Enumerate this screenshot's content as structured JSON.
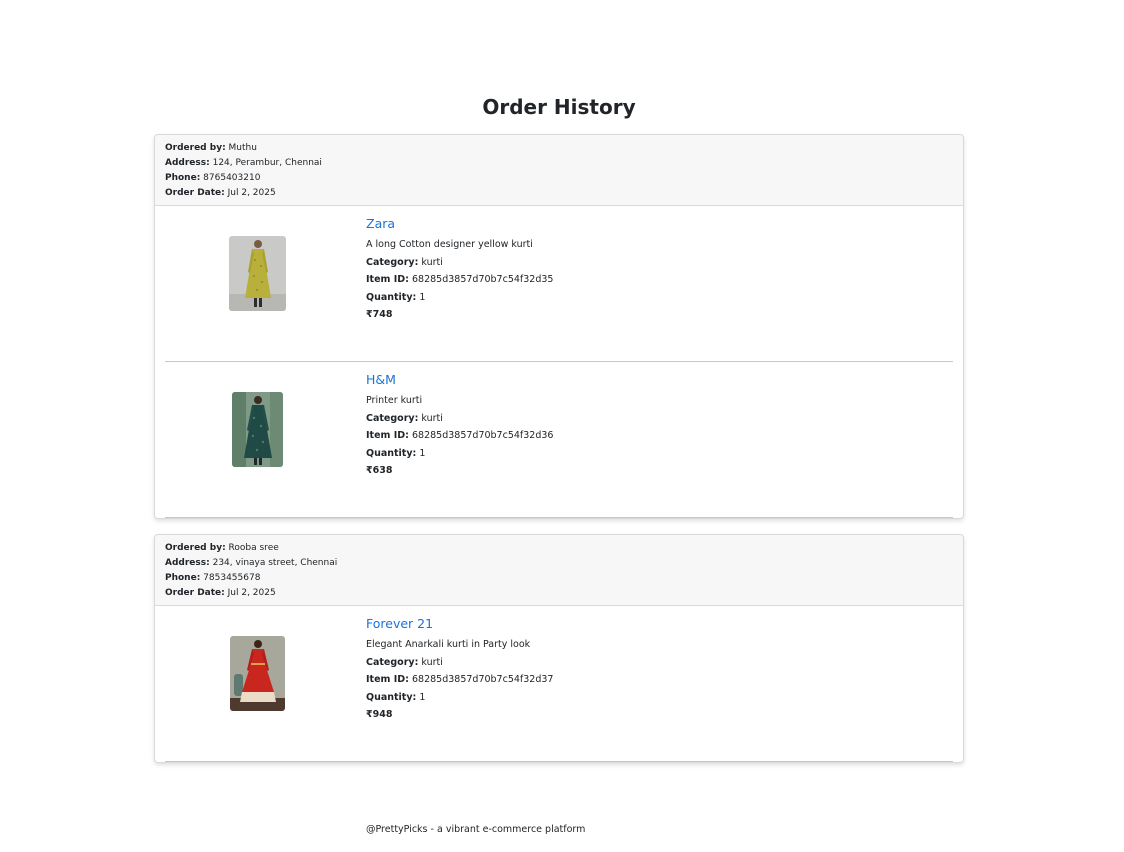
{
  "page": {
    "title": "Order History"
  },
  "labels": {
    "ordered_by": "Ordered by:",
    "address": "Address:",
    "phone": "Phone:",
    "order_date": "Order Date:",
    "category": "Category:",
    "item_id": "Item ID:",
    "quantity": "Quantity:"
  },
  "orders": [
    {
      "ordered_by": "Muthu",
      "address": "124, Perambur, Chennai",
      "phone": "8765403210",
      "order_date": "Jul 2, 2025",
      "items": [
        {
          "brand": "Zara",
          "description": "A long Cotton designer yellow kurti",
          "category": "kurti",
          "item_id": "68285d3857d70b7c54f32d35",
          "quantity": "1",
          "price": "₹748",
          "image": "yellow-kurti-photo"
        },
        {
          "brand": "H&M",
          "description": "Printer kurti",
          "category": "kurti",
          "item_id": "68285d3857d70b7c54f32d36",
          "quantity": "1",
          "price": "₹638",
          "image": "green-printed-kurti-photo"
        }
      ]
    },
    {
      "ordered_by": "Rooba sree",
      "address": "234, vinaya street, Chennai",
      "phone": "7853455678",
      "order_date": "Jul 2, 2025",
      "items": [
        {
          "brand": "Forever 21",
          "description": "Elegant Anarkali kurti in Party look",
          "category": "kurti",
          "item_id": "68285d3857d70b7c54f32d37",
          "quantity": "1",
          "price": "₹948",
          "image": "red-anarkali-kurti-photo"
        }
      ]
    }
  ],
  "footer": {
    "text": "@PrettyPicks - a vibrant e-commerce platform"
  }
}
